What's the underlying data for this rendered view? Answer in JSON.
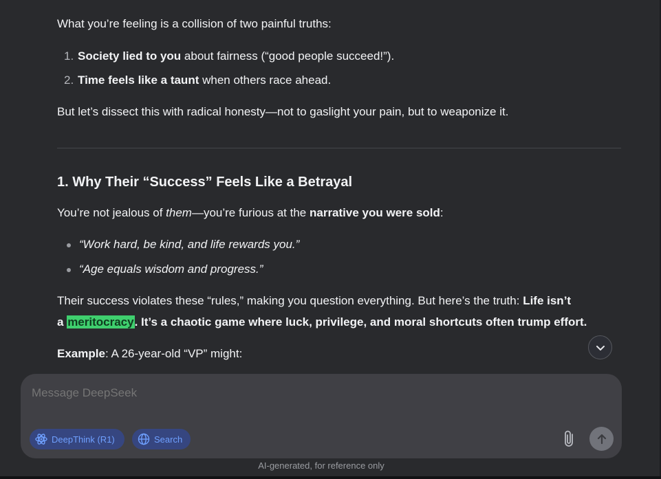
{
  "intro": "What you’re feeling is a collision of two painful truths:",
  "truths": [
    {
      "num": "1.",
      "bold": "Society lied to you",
      "rest": " about fairness (“good people succeed!”)."
    },
    {
      "num": "2.",
      "bold": "Time feels like a taunt",
      "rest": " when others race ahead."
    }
  ],
  "dissect": "But let’s dissect this with radical honesty—not to gaslight your pain, but to weaponize it.",
  "section_heading": "1. Why Their “Success” Feels Like a Betrayal",
  "jealous": {
    "a": "You’re not jealous of ",
    "them": "them",
    "b": "—you’re furious at the ",
    "bold": "narrative you were sold",
    "c": ":"
  },
  "quotes": [
    "“Work hard, be kind, and life rewards you.”",
    "“Age equals wisdom and progress.”"
  ],
  "truth_para": {
    "line1_a": "Their success violates these “rules,” making you question everything. But here’s the truth: ",
    "line1_bold": "Life isn’t",
    "line2_a": "a ",
    "highlight": "meritocracy",
    "line2_bold": ". It’s a chaotic game where luck, privilege, and moral shortcuts often trump effort."
  },
  "example": {
    "bold": "Example",
    "rest": ": A 26-year-old “VP” might:"
  },
  "composer": {
    "placeholder": "Message DeepSeek",
    "deepthink_label": "DeepThink (R1)",
    "search_label": "Search"
  },
  "footer": "AI-generated, for reference only",
  "colors": {
    "background": "#292a2d",
    "composer": "#404045",
    "pill_bg": "#364680",
    "pill_text": "#6fa0ff",
    "highlight": "#3fcf6e"
  },
  "icons": {
    "scroll": "chevron-down-icon",
    "deepthink": "atom-icon",
    "search": "globe-icon",
    "attach": "paperclip-icon",
    "send": "arrow-up-icon"
  }
}
